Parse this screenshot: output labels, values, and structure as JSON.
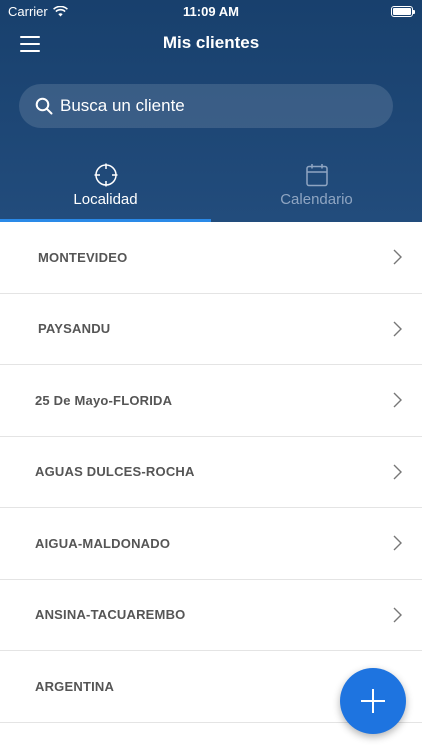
{
  "status_bar": {
    "carrier": "Carrier",
    "time": "11:09 AM",
    "wifi_icon": "wifi-icon",
    "battery_icon": "battery-icon"
  },
  "nav": {
    "title": "Mis clientes",
    "menu_icon": "hamburger-menu-icon"
  },
  "search": {
    "placeholder": "Busca un cliente",
    "value": "",
    "icon": "search-icon"
  },
  "tabs": [
    {
      "label": "Localidad",
      "icon": "crosshair-icon",
      "active": true
    },
    {
      "label": "Calendario",
      "icon": "calendar-icon",
      "active": false
    }
  ],
  "locations": [
    {
      "label": "MONTEVIDEO"
    },
    {
      "label": "PAYSANDU"
    },
    {
      "label": "25 De Mayo-FLORIDA"
    },
    {
      "label": "AGUAS DULCES-ROCHA"
    },
    {
      "label": "AIGUA-MALDONADO"
    },
    {
      "label": "ANSINA-TACUAREMBO"
    },
    {
      "label": "ARGENTINA"
    }
  ],
  "fab": {
    "icon": "plus-icon"
  },
  "colors": {
    "header_bg": "#1d4674",
    "tab_indicator": "#2a8ae8",
    "fab": "#1e74e0",
    "item_text": "#555555",
    "inactive_tab": "#8fa5c2"
  }
}
